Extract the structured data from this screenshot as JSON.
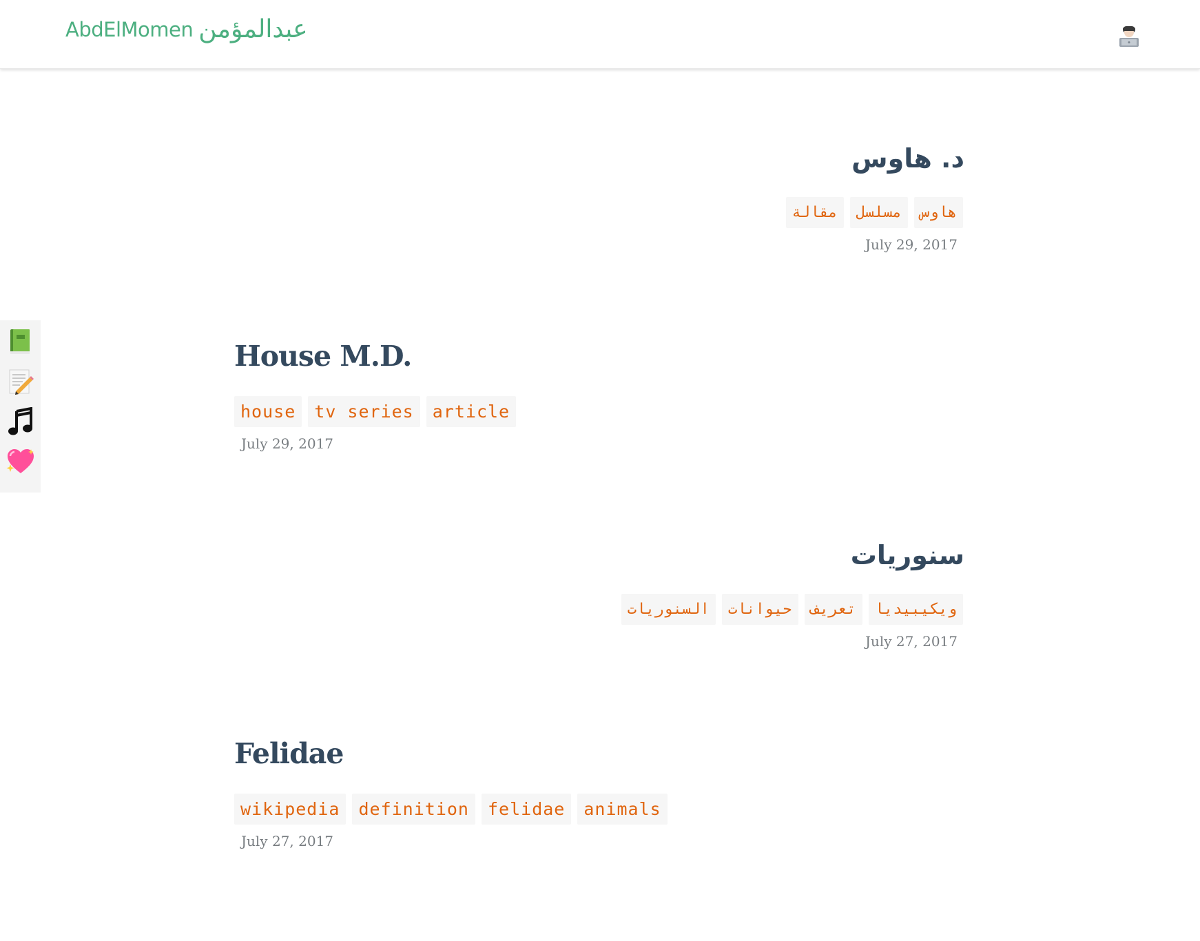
{
  "header": {
    "logo_latin": "AbdElMomen",
    "logo_arabic": "عبدالمؤمن"
  },
  "sidebar": {
    "items": [
      {
        "name": "book-icon",
        "glyph": "📗"
      },
      {
        "name": "memo-icon",
        "glyph": "📝"
      },
      {
        "name": "music-note-icon",
        "glyph": "🎵"
      },
      {
        "name": "sparkling-heart-icon",
        "glyph": "💖"
      }
    ]
  },
  "posts": [
    {
      "title": "د. هاوس",
      "dir": "rtl",
      "tags": [
        "هاوس",
        "مسلسل",
        "مقالة"
      ],
      "date": "July 29, 2017"
    },
    {
      "title": "House M.D.",
      "dir": "ltr",
      "tags": [
        "house",
        "tv series",
        "article"
      ],
      "date": "July 29, 2017"
    },
    {
      "title": "سنوريات",
      "dir": "rtl",
      "tags": [
        "ويكيبيديا",
        "تعريف",
        "حيوانات",
        "السنوريات"
      ],
      "date": "July 27, 2017"
    },
    {
      "title": "Felidae",
      "dir": "ltr",
      "tags": [
        "wikipedia",
        "definition",
        "felidae",
        "animals"
      ],
      "date": "July 27, 2017"
    }
  ],
  "colors": {
    "accent": "#4caf80",
    "title": "#34495e",
    "tag_text": "#e0650f",
    "tag_bg": "#f6f6f6",
    "date": "#777c80"
  }
}
